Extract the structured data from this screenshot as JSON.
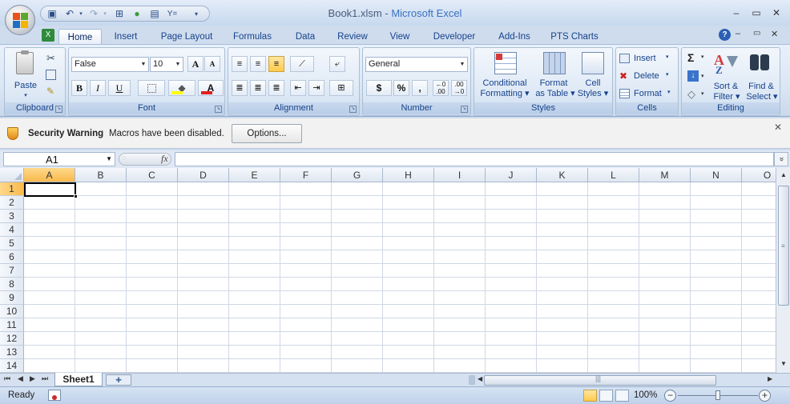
{
  "window": {
    "doc_name": "Book1.xlsm",
    "separator": " - ",
    "app_name": "Microsoft Excel",
    "minimize": "–",
    "restore": "▭",
    "close": "✕"
  },
  "tabs": [
    "Home",
    "Insert",
    "Page Layout",
    "Formulas",
    "Data",
    "Review",
    "View",
    "Developer",
    "Add-Ins",
    "PTS Charts"
  ],
  "ribbon": {
    "clipboard": {
      "label": "Clipboard",
      "paste": "Paste"
    },
    "font": {
      "label": "Font",
      "name": "False",
      "size": "10",
      "bold": "B",
      "italic": "I",
      "underline": "U",
      "grow": "A",
      "shrink": "A"
    },
    "alignment": {
      "label": "Alignment"
    },
    "number": {
      "label": "Number",
      "format": "General",
      "currency": "$",
      "percent": "%",
      "comma": ","
    },
    "styles": {
      "label": "Styles",
      "cond_1": "Conditional",
      "cond_2": "Formatting",
      "fmt_1": "Format",
      "fmt_2": "as Table",
      "cell_1": "Cell",
      "cell_2": "Styles"
    },
    "cells": {
      "label": "Cells",
      "insert": "Insert",
      "delete": "Delete",
      "format": "Format"
    },
    "editing": {
      "label": "Editing",
      "sigma": "Σ",
      "sort_1": "Sort &",
      "sort_2": "Filter",
      "find_1": "Find &",
      "find_2": "Select"
    }
  },
  "security": {
    "title": "Security Warning",
    "message": "Macros have been disabled.",
    "options": "Options...",
    "close": "✕"
  },
  "formula_bar": {
    "name_box": "A1",
    "fx": "fx",
    "value": "",
    "expand": "»"
  },
  "columns": [
    "A",
    "B",
    "C",
    "D",
    "E",
    "F",
    "G",
    "H",
    "I",
    "J",
    "K",
    "L",
    "M",
    "N",
    "O"
  ],
  "rows": [
    "1",
    "2",
    "3",
    "4",
    "5",
    "6",
    "7",
    "8",
    "9",
    "10",
    "11",
    "12",
    "13",
    "14"
  ],
  "active_cell": "A1",
  "sheet_tab": "Sheet1",
  "status": {
    "ready": "Ready",
    "zoom": "100%"
  }
}
